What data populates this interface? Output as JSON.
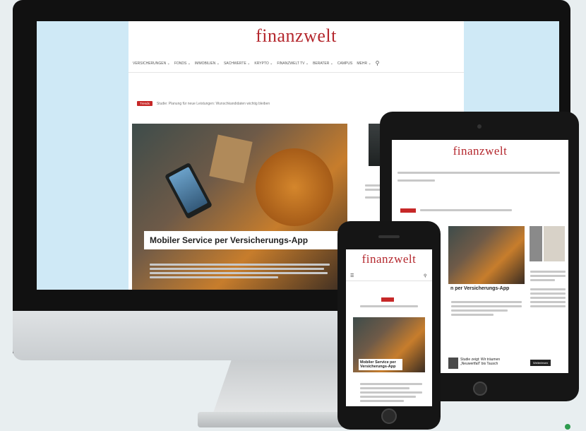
{
  "brand": {
    "logo": "finanzwelt",
    "accent_color": "#b4272d"
  },
  "desktop": {
    "nav": [
      {
        "label": "VERSICHERUNGEN ⌄"
      },
      {
        "label": "FONDS ⌄"
      },
      {
        "label": "IMMOBILIEN ⌄"
      },
      {
        "label": "SACHWERTE ⌄"
      },
      {
        "label": "KRYPTO ⌄"
      },
      {
        "label": "FINANZWELT TV ⌄"
      },
      {
        "label": "BERATER ⌄"
      },
      {
        "label": "CAMPUS"
      },
      {
        "label": "MEHR ⌄"
      }
    ],
    "search_icon": "search-icon",
    "breaking_tag": "Trends",
    "breaking_text": "Studie: Planung für neue Leistungen: Wunschkandidaten wichtig bleiben",
    "headline": "Mobiler Service per Versicherungs-App"
  },
  "tablet": {
    "headline": "n per Versicherungs-App",
    "side_headline": "Studie zeigt: Wir träumen „Neuwertfall“ bis Tausch",
    "button_label": "Weiterlesen"
  },
  "phone": {
    "headline": "Mobiler Service per Versicherungs-App"
  }
}
